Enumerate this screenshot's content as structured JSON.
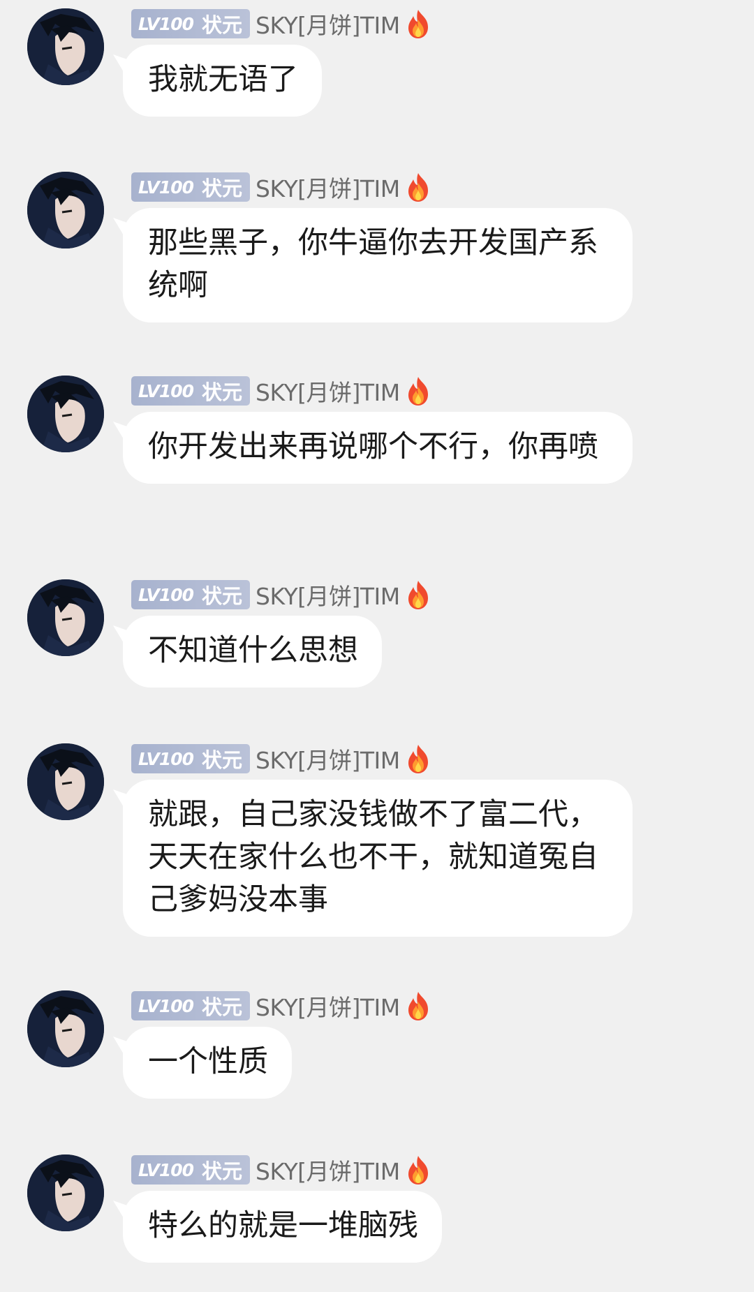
{
  "messages": [
    {
      "badge_level": "LV100",
      "badge_title": "状元",
      "nickname": "SKY[月饼]TIM",
      "text": "我就无语了",
      "icon": "fire-emoji"
    },
    {
      "badge_level": "LV100",
      "badge_title": "状元",
      "nickname": "SKY[月饼]TIM",
      "text": "那些黑子，你牛逼你去开发国产系统啊",
      "icon": "fire-emoji"
    },
    {
      "badge_level": "LV100",
      "badge_title": "状元",
      "nickname": "SKY[月饼]TIM",
      "text": "你开发出来再说哪个不行，你再喷",
      "icon": "fire-emoji"
    },
    {
      "badge_level": "LV100",
      "badge_title": "状元",
      "nickname": "SKY[月饼]TIM",
      "text": "不知道什么思想",
      "icon": "fire-emoji"
    },
    {
      "badge_level": "LV100",
      "badge_title": "状元",
      "nickname": "SKY[月饼]TIM",
      "text": "就跟，自己家没钱做不了富二代，天天在家什么也不干，就知道冤自己爹妈没本事",
      "icon": "fire-emoji"
    },
    {
      "badge_level": "LV100",
      "badge_title": "状元",
      "nickname": "SKY[月饼]TIM",
      "text": "一个性质",
      "icon": "fire-emoji"
    },
    {
      "badge_level": "LV100",
      "badge_title": "状元",
      "nickname": "SKY[月饼]TIM",
      "text": "特么的就是一堆脑残",
      "icon": "fire-emoji"
    }
  ]
}
